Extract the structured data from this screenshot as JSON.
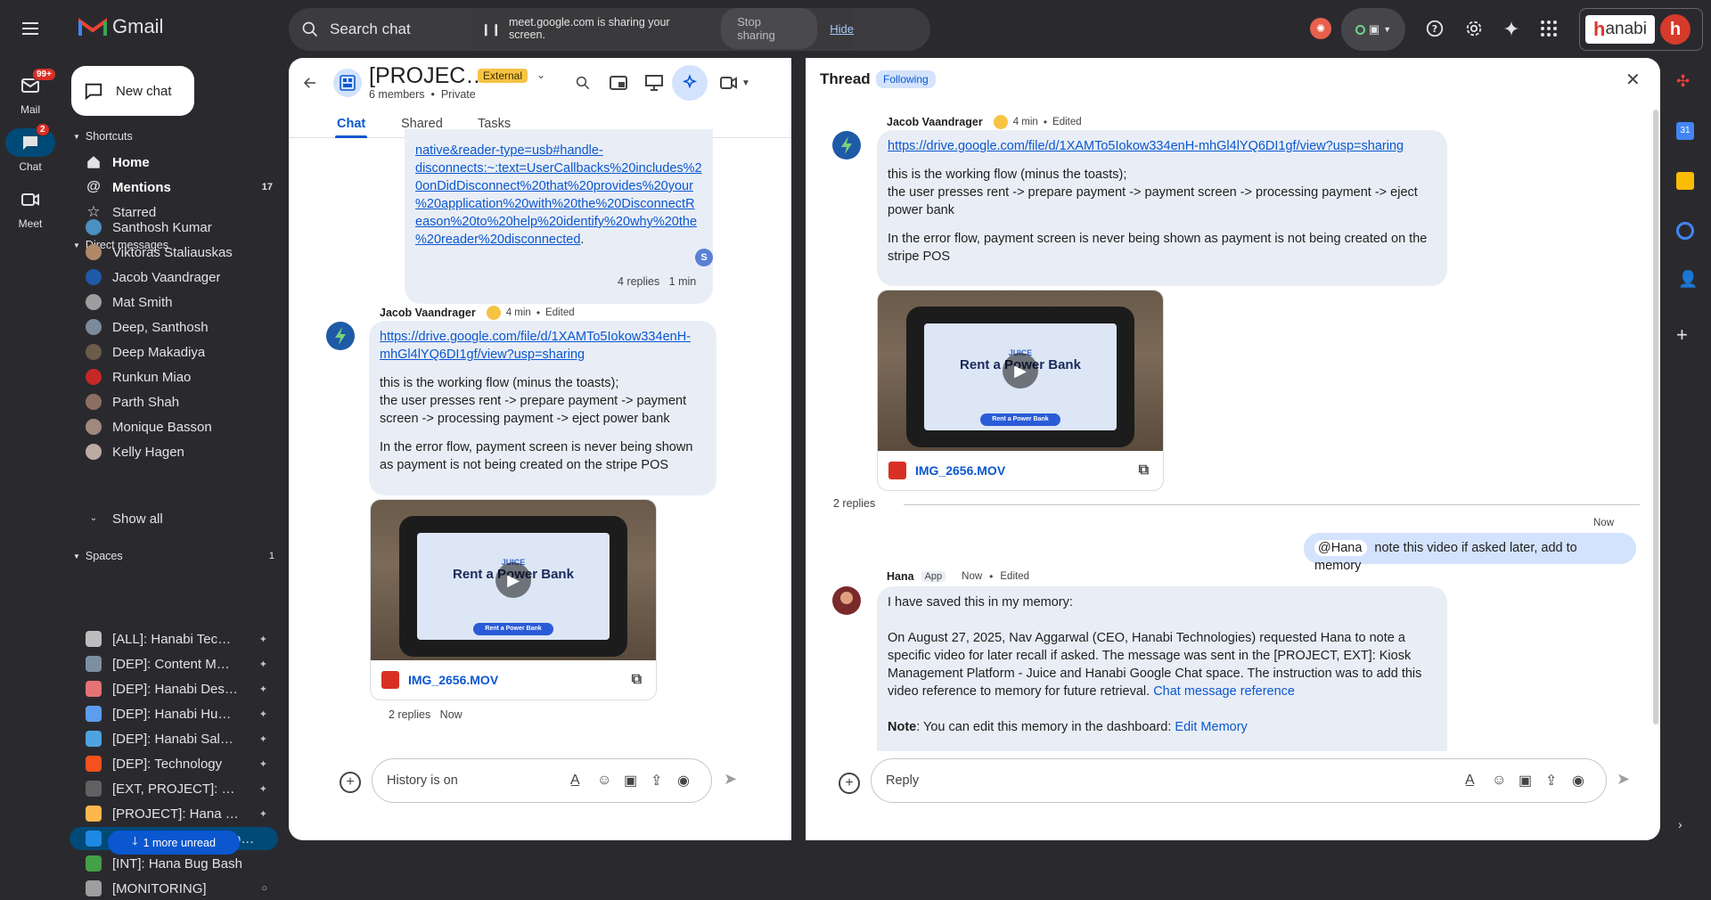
{
  "app": {
    "name": "Gmail"
  },
  "search": {
    "placeholder": "Search chat"
  },
  "screen_share": {
    "message": "meet.google.com is sharing your screen.",
    "stop_label": "Stop sharing",
    "hide_label": "Hide"
  },
  "brand": {
    "logo_text": "anabi",
    "logo_letter": "h"
  },
  "rail": {
    "mail": {
      "label": "Mail",
      "badge": "99+"
    },
    "chat": {
      "label": "Chat",
      "badge": "2"
    },
    "meet": {
      "label": "Meet"
    }
  },
  "sidebar": {
    "new_chat": "New chat",
    "shortcuts_header": "Shortcuts",
    "shortcuts": [
      {
        "label": "Home"
      },
      {
        "label": "Mentions",
        "count": "17"
      },
      {
        "label": "Starred"
      }
    ],
    "dm_header": "Direct messages",
    "dms": [
      {
        "label": "Santhosh Kumar",
        "color": "#4a90c2"
      },
      {
        "label": "Viktoras Staliauskas",
        "color": "#b08968"
      },
      {
        "label": "Jacob Vaandrager",
        "color": "#1e5aa8"
      },
      {
        "label": "Mat Smith",
        "color": "#9e9e9e"
      },
      {
        "label": "Deep, Santhosh",
        "color": "#7a8a9a"
      },
      {
        "label": "Deep Makadiya",
        "color": "#6b5b4a"
      },
      {
        "label": "Runkun Miao",
        "color": "#c62828"
      },
      {
        "label": "Parth Shah",
        "color": "#8d6e63"
      },
      {
        "label": "Monique Basson",
        "color": "#a1887f"
      },
      {
        "label": "Kelly Hagen",
        "color": "#bcaaa4"
      }
    ],
    "show_all": "Show all",
    "spaces_header": "Spaces",
    "spaces_count": "1",
    "spaces": [
      {
        "label": "[ALL]: Hanabi Tec…",
        "color": "#bdbdbd"
      },
      {
        "label": "[DEP]: Content M…",
        "color": "#7b8fa1"
      },
      {
        "label": "[DEP]: Hanabi Des…",
        "color": "#e57373"
      },
      {
        "label": "[DEP]: Hanabi Hu…",
        "color": "#5c9ded"
      },
      {
        "label": "[DEP]: Hanabi Sal…",
        "color": "#4fa3e0"
      },
      {
        "label": "[DEP]: Technology",
        "color": "#f4511e"
      },
      {
        "label": "[EXT, PROJECT]: …",
        "color": "#616161"
      },
      {
        "label": "[PROJECT]: Hana …",
        "color": "#ffb74d"
      },
      {
        "label": "[PROJECT, EXT]: Kiosk…",
        "color": "#1e88e5"
      },
      {
        "label": "[INT]: Hana Bug Bash",
        "color": "#43a047"
      },
      {
        "label": "[MONITORING]",
        "color": "#9e9e9e"
      }
    ],
    "more_unread": "1 more unread"
  },
  "chat": {
    "title": "[PROJEC…",
    "external_badge": "External",
    "members": "6 members",
    "privacy": "Private",
    "tabs": [
      {
        "label": "Chat"
      },
      {
        "label": "Shared"
      },
      {
        "label": "Tasks"
      }
    ],
    "prev_link_lines": [
      "native&reader-type=usb#handle-",
      "disconnects:~:text=UserCallbacks%20includes%2",
      "0onDidDisconnect%20that%20provides%20your",
      "%20application%20with%20the%20DisconnectR",
      "eason%20to%20help%20identify%20why%20the",
      "%20reader%20disconnected"
    ],
    "prev_link_suffix": ".",
    "prev_reaction": "S",
    "prev_replies": "4 replies",
    "prev_replies_time": "1 min",
    "msg": {
      "sender": "Jacob Vaandrager",
      "time": "4 min",
      "edited": "Edited",
      "link_lines": [
        "https://drive.google.com/file/d/1XAMTo5Iokow334enH-",
        "mhGl4lYQ6DI1gf/view?usp=sharing"
      ],
      "text1": "this is the working flow (minus the toasts);",
      "text2": "the user presses rent -> prepare payment -> payment screen -> processing payment -> eject power bank",
      "text3": "In the error flow, payment screen is never being shown as payment is not being created on the stripe POS",
      "video_title": "Rent a Power Bank",
      "video_brand": "JUICE",
      "video_button": "Rent a Power Bank",
      "file": "IMG_2656.MOV",
      "replies": "2 replies",
      "replies_time": "Now"
    },
    "composer_placeholder": "History is on"
  },
  "thread": {
    "title": "Thread",
    "following": "Following",
    "parent": {
      "sender": "Jacob Vaandrager",
      "time": "4 min",
      "edited": "Edited",
      "link": "https://drive.google.com/file/d/1XAMTo5Iokow334enH-mhGl4lYQ6DI1gf/view?usp=sharing",
      "text1": "this is the working flow (minus the toasts);",
      "text2": "the user presses rent -> prepare payment -> payment screen -> processing payment -> eject power bank",
      "text3": "In the error flow, payment screen is never being shown as payment is not being created on the stripe POS",
      "file": "IMG_2656.MOV"
    },
    "replies_count": "2 replies",
    "reply1": {
      "time": "Now",
      "mention": "@Hana",
      "text": "note this video if asked later, add to memory"
    },
    "reply2": {
      "sender": "Hana",
      "app_tag": "App",
      "time": "Now",
      "edited": "Edited",
      "line1": "I have saved this in my memory:",
      "para": "On August 27, 2025, Nav Aggarwal (CEO, Hanabi Technologies) requested Hana to note a specific video for later recall if asked. The message was sent in the [PROJECT, EXT]: Kiosk Management Platform - Juice and Hanabi Google Chat space. The instruction was to add this video reference to memory for future retrieval.",
      "ref_link": "Chat message reference",
      "note_label": "Note",
      "note_text": ": You can edit this memory in the dashboard: ",
      "note_link": "Edit Memory"
    },
    "composer_placeholder": "Reply"
  },
  "colors": {
    "accent": "#0b57d0",
    "bubble": "#e9eef6",
    "dark_bg": "#2a2a2e"
  }
}
